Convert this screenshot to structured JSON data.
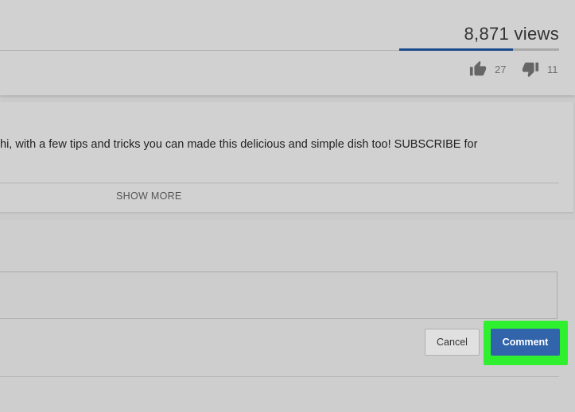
{
  "video": {
    "views": "8,871 views",
    "likes": "27",
    "dislikes": "11",
    "like_ratio": 0.71
  },
  "description": {
    "text": "hi, with a few tips and tricks you can made this delicious and simple dish too! SUBSCRIBE for",
    "show_more_label": "SHOW MORE"
  },
  "comment": {
    "cancel_label": "Cancel",
    "submit_label": "Comment"
  },
  "icons": [
    "thumbs-up-icon",
    "thumbs-down-icon"
  ],
  "colors": {
    "accent": "#3264ab",
    "sentiment": "#1d4a8c",
    "highlight": "#2ff02f"
  }
}
